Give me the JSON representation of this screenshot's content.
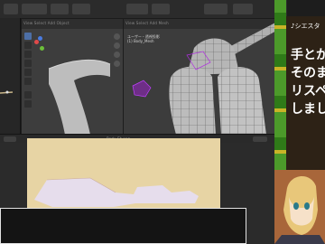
{
  "vp1": {
    "menu_text": "View  Select  Add  Object"
  },
  "vp2": {
    "menu_text": "View  Select  Add  Mesh",
    "info_line1": "ユーザー・透視投影",
    "info_line2": "(1) Body_Mesh"
  },
  "timeline": {
    "label": "Body_Eb.png"
  },
  "overlay": {
    "title": "♪シエスタ",
    "lines": [
      "手とか",
      "そのま",
      "リスペ",
      "しまし"
    ]
  },
  "colors": {
    "blender_bg": "#232323",
    "viewport_bg": "#3d3d3d",
    "texture_bg": "#e7d4a4",
    "uv_island": "#e6ddec",
    "mesh_select": "#a020d0",
    "overlay_green": "#4c9a2a"
  },
  "icons": {
    "tools": [
      "select-box-icon",
      "cursor-icon",
      "move-icon",
      "rotate-icon",
      "scale-icon",
      "transform-icon",
      "annotate-icon",
      "measure-icon"
    ],
    "gizmo": [
      "x-axis-icon",
      "y-axis-icon",
      "z-axis-icon"
    ]
  }
}
